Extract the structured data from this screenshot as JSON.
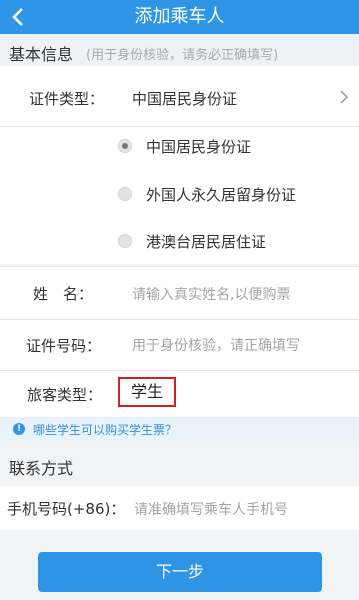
{
  "header": {
    "title": "添加乘车人"
  },
  "basic_info": {
    "title": "基本信息",
    "subtitle": "(用于身份核验，请务必正确填写)",
    "id_type_label": "证件类型：",
    "id_type_value": "中国居民身份证",
    "id_type_options": [
      {
        "label": "中国居民身份证",
        "checked": true
      },
      {
        "label": "外国人永久居留身份证",
        "checked": false
      },
      {
        "label": "港澳台居民居住证",
        "checked": false
      }
    ],
    "name_label": "姓　名：",
    "name_placeholder": "请输入真实姓名,以便购票",
    "id_number_label": "证件号码：",
    "id_number_placeholder": "用于身份核验，请正确填写",
    "passenger_type_label": "旅客类型：",
    "passenger_type_value": "学生",
    "student_tip": "哪些学生可以购买学生票？"
  },
  "contact": {
    "title": "联系方式",
    "phone_label": "手机号码(+86)：",
    "phone_placeholder": "请准确填写乘车人手机号"
  },
  "footer": {
    "next_label": "下一步"
  },
  "colors": {
    "accent": "#2f95e6",
    "highlight_border": "#cc2222"
  }
}
